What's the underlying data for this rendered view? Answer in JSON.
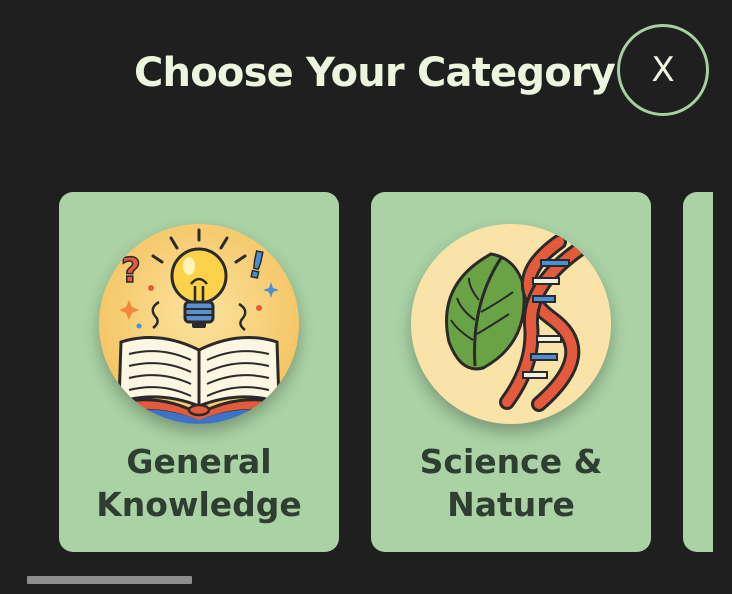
{
  "header": {
    "title": "Choose Your Category",
    "close_label": "X"
  },
  "categories": [
    {
      "label": "General Knowledge",
      "icon": "book-lightbulb-icon"
    },
    {
      "label": "Science & Nature",
      "icon": "leaf-dna-icon"
    },
    {
      "label": "",
      "icon": ""
    }
  ],
  "colors": {
    "background": "#1f1f1f",
    "card": "#aad2a5",
    "title_text": "#eef5df",
    "card_text": "#2e3f32",
    "accent_border": "#a7cfa1",
    "scrollbar": "#8d8d8d"
  }
}
